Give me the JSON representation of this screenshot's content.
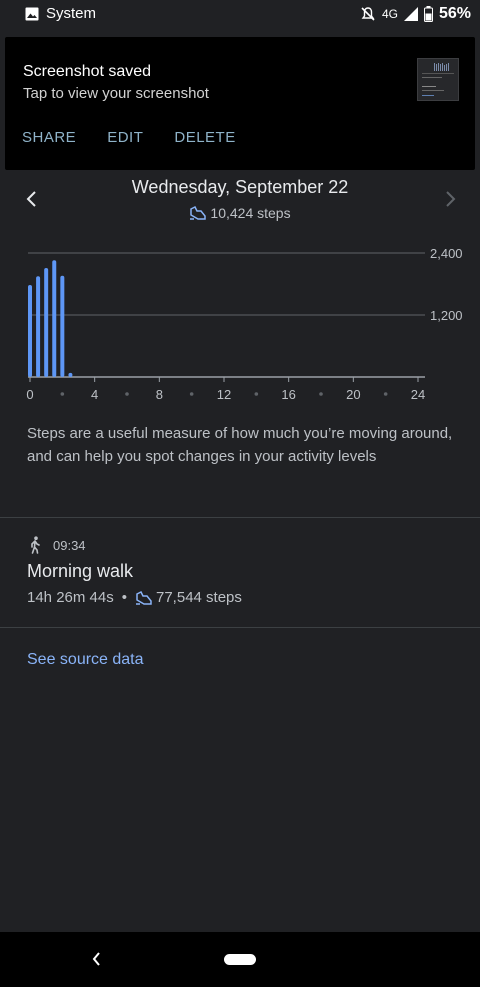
{
  "status_bar": {
    "app_label": "System",
    "network": "4G",
    "battery": "56%",
    "icons": [
      "image-icon",
      "do-not-disturb-icon",
      "signal-icon",
      "battery-icon"
    ]
  },
  "notification": {
    "title": "Screenshot saved",
    "subtitle": "Tap to view your screenshot",
    "actions": [
      "SHARE",
      "EDIT",
      "DELETE"
    ],
    "thumbnail": "screenshot-thumbnail"
  },
  "day": {
    "title": "Wednesday, September 22",
    "steps": "10,424 steps",
    "prev_icon": "chevron-left-icon",
    "next_icon": "chevron-right-icon"
  },
  "chart_data": {
    "type": "bar",
    "x": [
      0,
      0.5,
      1,
      1.5,
      2,
      2.5
    ],
    "values": [
      1780,
      1950,
      2110,
      2260,
      1960,
      80
    ],
    "xlim": [
      0,
      24
    ],
    "ylim": [
      0,
      2400
    ],
    "x_ticks": [
      "0",
      "4",
      "8",
      "12",
      "16",
      "20",
      "24"
    ],
    "y_ticks": [
      "1,200",
      "2,400"
    ],
    "bar_color": "#5e97f6",
    "grid": true
  },
  "description": "Steps are a useful measure of how much you’re moving around, and can help you spot changes in your activity levels",
  "session": {
    "time": "09:34",
    "title": "Morning walk",
    "duration": "14h 26m 44s",
    "separator": "•",
    "steps": "77,544 steps",
    "icon": "walking-icon"
  },
  "source_link": "See source data",
  "colors": {
    "background": "#202124",
    "accent": "#8ab4f8",
    "bar": "#5e97f6"
  }
}
